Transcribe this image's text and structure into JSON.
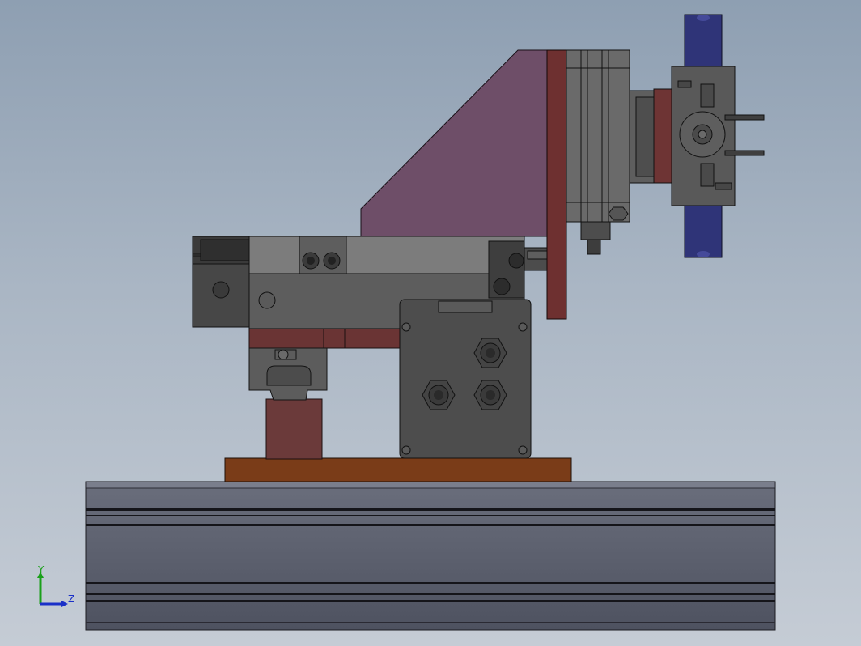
{
  "viewport": {
    "background_top": "#8e9fb2",
    "background_bottom": "#c5ccd5"
  },
  "model": {
    "parts": [
      {
        "name": "base-rail",
        "color": "#585c6a"
      },
      {
        "name": "mount-plate",
        "color": "#7d3d1a"
      },
      {
        "name": "slide-block",
        "color": "#6b3b3b"
      },
      {
        "name": "slide-carriage",
        "color": "#5c5c5c"
      },
      {
        "name": "linear-cylinder",
        "color": "#4a4a4a"
      },
      {
        "name": "cylinder-body",
        "color": "#7e7e7e"
      },
      {
        "name": "support-bracket",
        "color": "#6f4f6a"
      },
      {
        "name": "vertical-plate",
        "color": "#6e3030"
      },
      {
        "name": "rotary-actuator",
        "color": "#555555"
      },
      {
        "name": "gripper-jaws",
        "color": "#2f3480"
      },
      {
        "name": "gripper-body",
        "color": "#5a5a5a"
      },
      {
        "name": "junction-box",
        "color": "#4d4d4d"
      }
    ],
    "connectors": 3
  },
  "triad": {
    "y_label": "Y",
    "z_label": "Z",
    "y_color": "#1aa01a",
    "z_color": "#1a30c8"
  }
}
